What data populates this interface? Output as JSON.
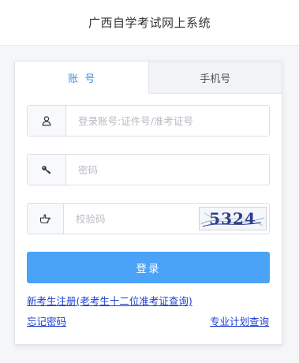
{
  "header": {
    "title": "广西自学考试网上系统"
  },
  "tabs": [
    {
      "label": "账  号",
      "active": true
    },
    {
      "label": "手机号",
      "active": false
    }
  ],
  "fields": {
    "account": {
      "placeholder": "登录账号:证件号/准考证号",
      "icon": "user-icon"
    },
    "password": {
      "placeholder": "密码",
      "icon": "key-icon"
    },
    "captcha": {
      "placeholder": "校验码",
      "icon": "hand-pointer-icon",
      "code": "5324"
    }
  },
  "buttons": {
    "login": "登录"
  },
  "links": {
    "register": "新考生注册(老考生十二位准考证查询)",
    "forgot": "忘记密码",
    "plan": "专业计划查询"
  },
  "colors": {
    "accent": "#4aa3f7",
    "tab_active": "#4a90e2",
    "link": "#1c3fd0"
  }
}
